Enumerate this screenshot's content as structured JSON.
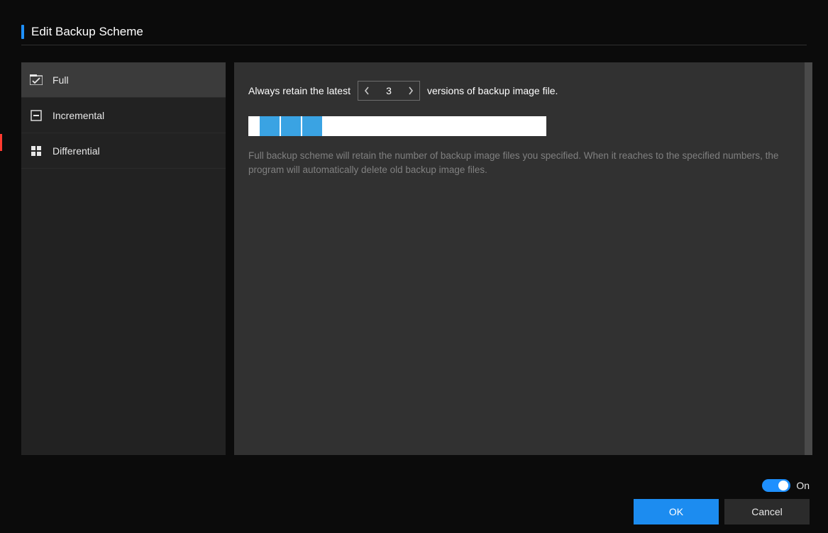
{
  "title": "Edit Backup Scheme",
  "sidebar": {
    "items": [
      {
        "label": "Full",
        "icon": "full"
      },
      {
        "label": "Incremental",
        "icon": "incremental"
      },
      {
        "label": "Differential",
        "icon": "differential"
      }
    ]
  },
  "content": {
    "retain_prefix": "Always retain the latest",
    "retain_value": "3",
    "retain_suffix": "versions of backup image file.",
    "description": "Full backup scheme will retain the number of backup image files you specified. When it reaches to the specified numbers, the program will automatically delete old backup image files."
  },
  "footer": {
    "toggle_state_label": "On",
    "ok_label": "OK",
    "cancel_label": "Cancel"
  },
  "colors": {
    "accent": "#1e90ff",
    "block": "#3aa3e3"
  }
}
